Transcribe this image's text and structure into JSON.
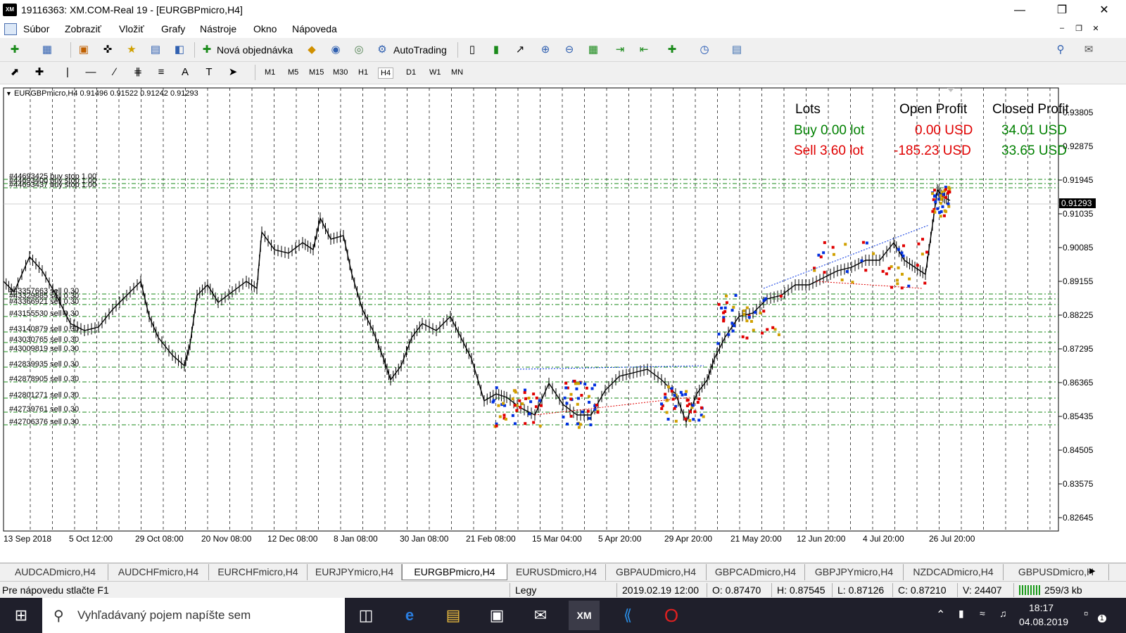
{
  "window": {
    "title": "19116363: XM.COM-Real 19 - [EURGBPmicro,H4]",
    "app_icon": "XM",
    "controls": [
      "minimize-icon",
      "maximize-icon",
      "close-icon"
    ]
  },
  "menu": {
    "items": [
      "Súbor",
      "Zobraziť",
      "Vložiť",
      "Grafy",
      "Nástroje",
      "Okno",
      "Nápoveda"
    ]
  },
  "toolbar": {
    "new_order_label": "Nová objednávka",
    "autotrading_label": "AutoTrading"
  },
  "timeframes": [
    "M1",
    "M5",
    "M15",
    "M30",
    "H1",
    "H4",
    "D1",
    "W1",
    "MN"
  ],
  "active_timeframe": "H4",
  "chart": {
    "header": "EURGBPmicro,H4  0.91496 0.91522 0.91242 0.91293",
    "current_price": "0.91293",
    "price_axis": [
      "0.93805",
      "0.92875",
      "0.91945",
      "0.91035",
      "0.90085",
      "0.89155",
      "0.88225",
      "0.87295",
      "0.86365",
      "0.85435",
      "0.84505",
      "0.83575",
      "0.82645"
    ],
    "time_axis": [
      "13 Sep 2018",
      "5 Oct 12:00",
      "29 Oct 08:00",
      "20 Nov 08:00",
      "12 Dec 08:00",
      "8 Jan 08:00",
      "30 Jan 08:00",
      "21 Feb 08:00",
      "15 Mar 04:00",
      "5 Apr 20:00",
      "29 Apr 20:00",
      "21 May 20:00",
      "12 Jun 20:00",
      "4 Jul 20:00",
      "26 Jul 20:00"
    ],
    "buy_stop_labels": [
      "#44693425 buy stop 1.00",
      "#44693400 buy stop 1.00",
      "#44693437 buy stop 1.00"
    ],
    "sell_labels": [
      "#43357663 sell 0.30",
      "#43329885 sell 0.30",
      "#43366921 sell 0.30",
      "#43155530 sell 0.30",
      "#43140879 sell 0.30",
      "#43030765 sell 0.30",
      "#43009819 sell 0.30",
      "#42839935 sell 0.30",
      "#42878905 sell 0.30",
      "#42801271 sell 0.30",
      "#42739761 sell 0.30",
      "#42706376 sell 0.30"
    ],
    "info_panel": {
      "headers": [
        "Lots",
        "Open Profit",
        "Closed Profit"
      ],
      "buy": {
        "lots": "Buy 0.00 lot",
        "open": "0.00 USD",
        "closed": "34.01 USD"
      },
      "sell": {
        "lots": "Sell 3.60 lot",
        "open": "-185.23 USD",
        "closed": "33.65 USD"
      },
      "colors": {
        "buy": "#008000",
        "sell": "#e00000",
        "closed": "#008000"
      }
    }
  },
  "tabs": [
    "AUDCADmicro,H4",
    "AUDCHFmicro,H4",
    "EURCHFmicro,H4",
    "EURJPYmicro,H4",
    "EURGBPmicro,H4",
    "EURUSDmicro,H4",
    "GBPAUDmicro,H4",
    "GBPCADmicro,H4",
    "GBPJPYmicro,H4",
    "NZDCADmicro,H4",
    "GBPUSDmicro,H"
  ],
  "active_tab": "EURGBPmicro,H4",
  "status": {
    "help": "Pre nápovedu stlačte F1",
    "profile": "Legy",
    "datetime": "2019.02.19 12:00",
    "open": "O: 0.87470",
    "high": "H: 0.87545",
    "low": "L: 0.87126",
    "close": "C: 0.87210",
    "volume": "V: 24407",
    "traffic": "259/3 kb"
  },
  "taskbar": {
    "search_placeholder": "Vyhľadávaný pojem napíšte sem",
    "time": "18:17",
    "date": "04.08.2019",
    "notifications": "1",
    "apps": [
      "task-view-icon",
      "edge-icon",
      "explorer-icon",
      "store-icon",
      "mail-icon",
      "xm-icon",
      "vscode-icon",
      "opera-icon"
    ]
  }
}
